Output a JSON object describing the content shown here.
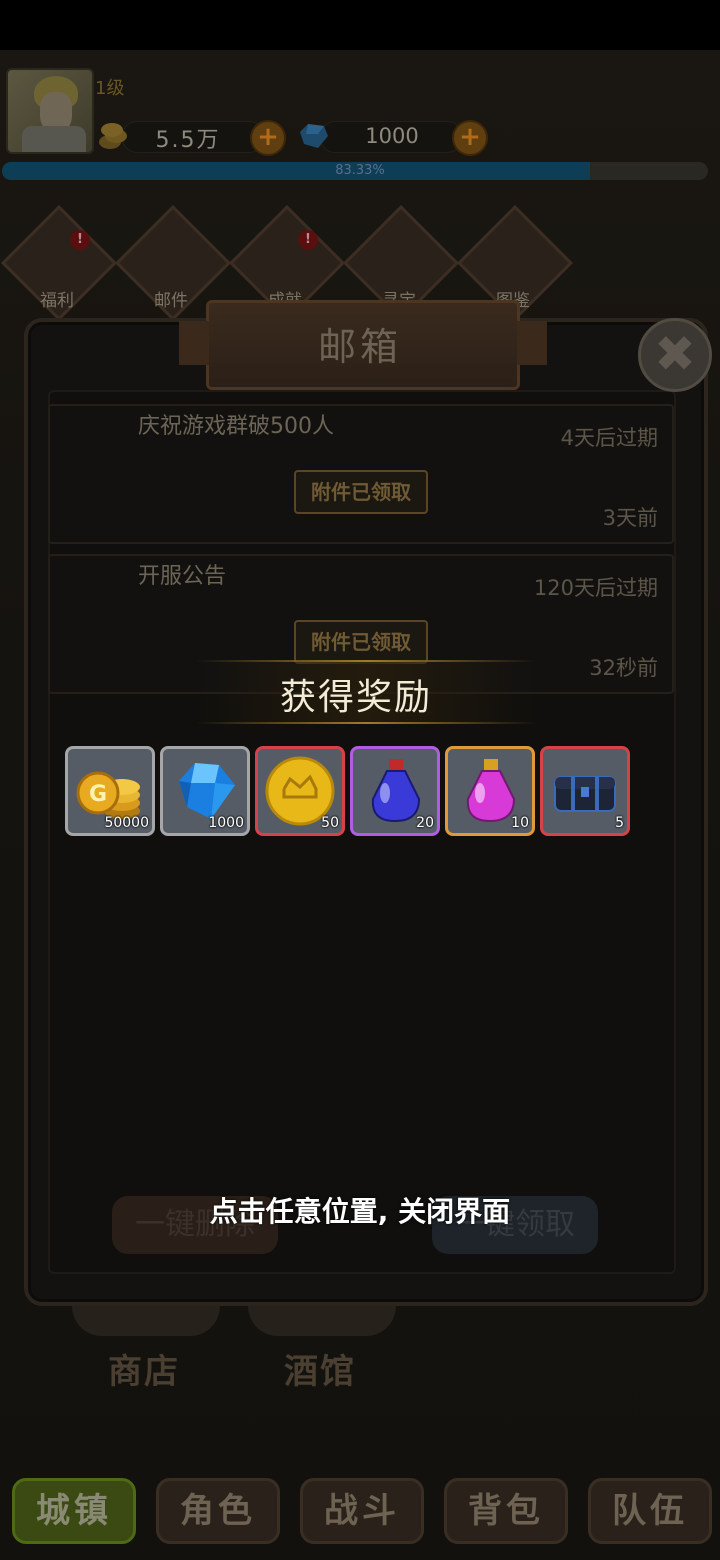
{
  "header": {
    "level": "1级",
    "coins": "5.5万",
    "gems": "1000",
    "exp_text": "83.33%",
    "exp_fraction": 0.8333
  },
  "top_menu": [
    {
      "label": "福利",
      "icon": "gift-crest-icon",
      "badge": "!"
    },
    {
      "label": "邮件",
      "icon": "mail-icon",
      "badge": ""
    },
    {
      "label": "成就",
      "icon": "achievement-icon",
      "badge": "!"
    },
    {
      "label": "寻宝",
      "icon": "treasure-chest-icon",
      "badge": ""
    },
    {
      "label": "图鉴",
      "icon": "codex-crest-icon",
      "badge": ""
    }
  ],
  "scene": {
    "shop_label": "商店",
    "tavern_label": "酒馆"
  },
  "mailbox": {
    "title": "邮箱",
    "close_icon": "close-icon",
    "mails": [
      {
        "subject": "庆祝游戏群破500人",
        "expire": "4天后过期",
        "button": "附件已领取",
        "time": "3天前"
      },
      {
        "subject": "开服公告",
        "expire": "120天后过期",
        "button": "附件已领取",
        "time": "32秒前"
      }
    ],
    "delete_all": "一键删除",
    "claim_all": "一键领取"
  },
  "reward": {
    "title": "获得奖励",
    "items": [
      {
        "name": "gold-coins-icon",
        "count": "50000",
        "border": "#a4a6a8"
      },
      {
        "name": "blue-diamond-icon",
        "count": "1000",
        "border": "#a4a6a8"
      },
      {
        "name": "crown-coin-icon",
        "count": "50",
        "border": "#d6424a"
      },
      {
        "name": "blue-potion-icon",
        "count": "20",
        "border": "#b05ee0"
      },
      {
        "name": "pink-potion-icon",
        "count": "10",
        "border": "#e09a3a"
      },
      {
        "name": "dark-chest-icon",
        "count": "5",
        "border": "#d6424a"
      }
    ],
    "close_hint": "点击任意位置, 关闭界面"
  },
  "bottom_nav": [
    {
      "label": "城镇",
      "active": true
    },
    {
      "label": "角色",
      "active": false
    },
    {
      "label": "战斗",
      "active": false
    },
    {
      "label": "背包",
      "active": false
    },
    {
      "label": "队伍",
      "active": false
    }
  ]
}
